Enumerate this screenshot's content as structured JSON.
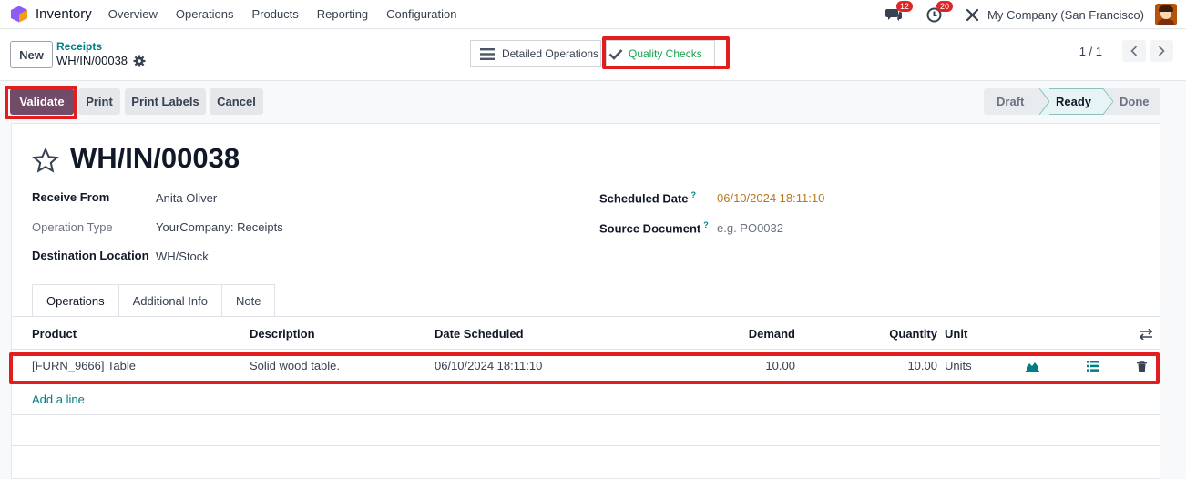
{
  "topbar": {
    "app_name": "Inventory",
    "menu": [
      "Overview",
      "Operations",
      "Products",
      "Reporting",
      "Configuration"
    ],
    "messages_count": "12",
    "activities_count": "20",
    "company": "My Company (San Francisco)"
  },
  "control_panel": {
    "new_label": "New",
    "breadcrumb_parent": "Receipts",
    "breadcrumb_current": "WH/IN/00038",
    "smart_buttons": {
      "detailed_operations": "Detailed Operations",
      "quality_checks": "Quality Checks"
    },
    "pager": "1 / 1"
  },
  "actions": {
    "validate": "Validate",
    "print": "Print",
    "print_labels": "Print Labels",
    "cancel": "Cancel"
  },
  "statusbar": {
    "stages": [
      "Draft",
      "Ready",
      "Done"
    ],
    "active": "Ready"
  },
  "record": {
    "name": "WH/IN/00038",
    "fields_left": [
      {
        "label": "Receive From",
        "value": "Anita Oliver"
      },
      {
        "label": "Operation Type",
        "value": "YourCompany: Receipts"
      },
      {
        "label": "Destination Location",
        "value": "WH/Stock"
      }
    ],
    "scheduled_date_label": "Scheduled Date",
    "scheduled_date": "06/10/2024 18:11:10",
    "source_document_label": "Source Document",
    "source_document_placeholder": "e.g. PO0032",
    "help_mark": "?"
  },
  "tabs": [
    "Operations",
    "Additional Info",
    "Note"
  ],
  "table": {
    "columns": [
      "Product",
      "Description",
      "Date Scheduled",
      "Demand",
      "Quantity",
      "Unit"
    ],
    "rows": [
      {
        "product": "[FURN_9666] Table",
        "description": "Solid wood table.",
        "date_scheduled": "06/10/2024 18:11:10",
        "demand": "10.00",
        "quantity": "10.00",
        "unit": "Units"
      }
    ],
    "add_line": "Add a line"
  },
  "colors": {
    "primary": "#714b67",
    "link": "#017e84",
    "highlight": "#e11d1d",
    "warning_date": "#b7791f",
    "success": "#16a34a"
  }
}
